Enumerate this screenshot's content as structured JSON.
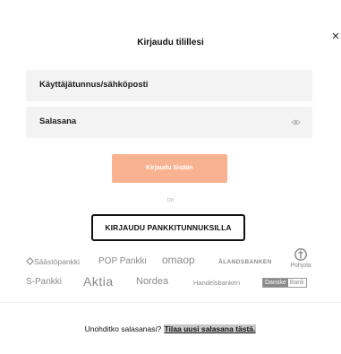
{
  "login": {
    "title": "Kirjaudu tilillesi",
    "username_placeholder": "Käyttäjätunnus/sähköposti",
    "password_placeholder": "Salasana",
    "submit_label": "Kirjaudu Sisään",
    "or_text": "tai",
    "bank_login_label": "KIRJAUDU PANKKITUNNUKSILLA"
  },
  "banks": {
    "saastopankki": "Säästöpankki",
    "pop_pankki": "POP Pankki",
    "omaop": "omaop",
    "alandsbanken": "ÅLANDSBANKEN",
    "pohjola": "Pohjola",
    "s_pankki": "S-Pankki",
    "aktia": "Aktia",
    "nordea": "Nordea",
    "handelsbanken": "Handelsbanken",
    "danske": "Danske",
    "danske_bank": "Bank"
  },
  "footer": {
    "question": "Unohditko salasanasi?",
    "link": "Tilaa uusi salasana tästä."
  },
  "colors": {
    "primary_button": "#f9b28f",
    "field_bg": "#f3f3f3",
    "bank_logo_gray": "#8a8a8a"
  },
  "icons": {
    "close": "close-icon",
    "password_toggle": "eye-icon",
    "pohjola_logo": "pohjola-logo-icon",
    "saastopankki_logo": "saastopankki-logo-icon"
  }
}
